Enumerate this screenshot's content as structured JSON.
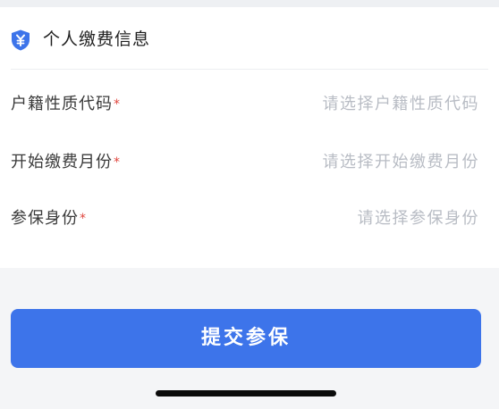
{
  "section": {
    "title": "个人缴费信息",
    "icon": "shield-yen-icon",
    "accent_color": "#3d74ea"
  },
  "form": {
    "fields": [
      {
        "label": "户籍性质代码",
        "required_mark": "*",
        "placeholder": "请选择户籍性质代码"
      },
      {
        "label": "开始缴费月份",
        "required_mark": "*",
        "placeholder": "请选择开始缴费月份"
      },
      {
        "label": "参保身份",
        "required_mark": "*",
        "placeholder": "请选择参保身份"
      }
    ]
  },
  "actions": {
    "submit_label": "提交参保",
    "submit_color": "#3d74ea"
  }
}
